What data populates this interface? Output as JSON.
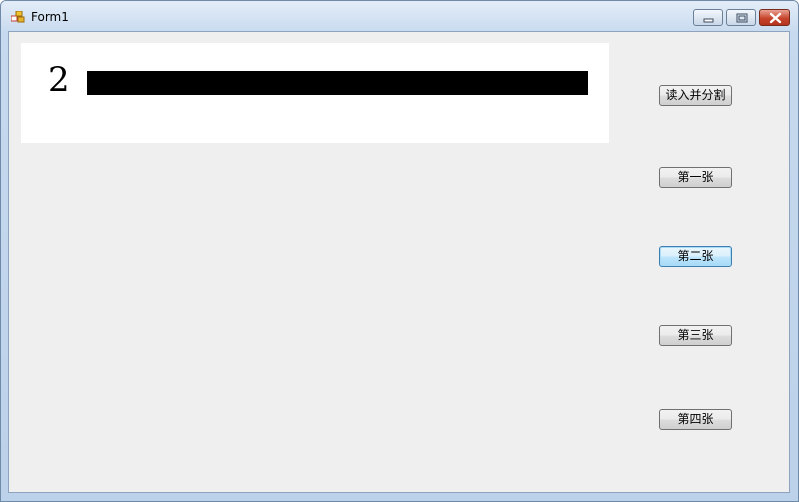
{
  "window": {
    "title": "Form1",
    "icon": "form-app-icon",
    "caption_buttons": [
      "minimize-icon",
      "maximize-icon",
      "close-icon"
    ]
  },
  "picture": {
    "digit": "2"
  },
  "buttons": {
    "read_split": "读入并分割",
    "first": "第一张",
    "second": "第二张",
    "third": "第三张",
    "fourth": "第四张"
  },
  "colors": {
    "client_background": "#efefef",
    "focused_button_border": "#3c7fb1",
    "close_button": "#c8452d"
  }
}
